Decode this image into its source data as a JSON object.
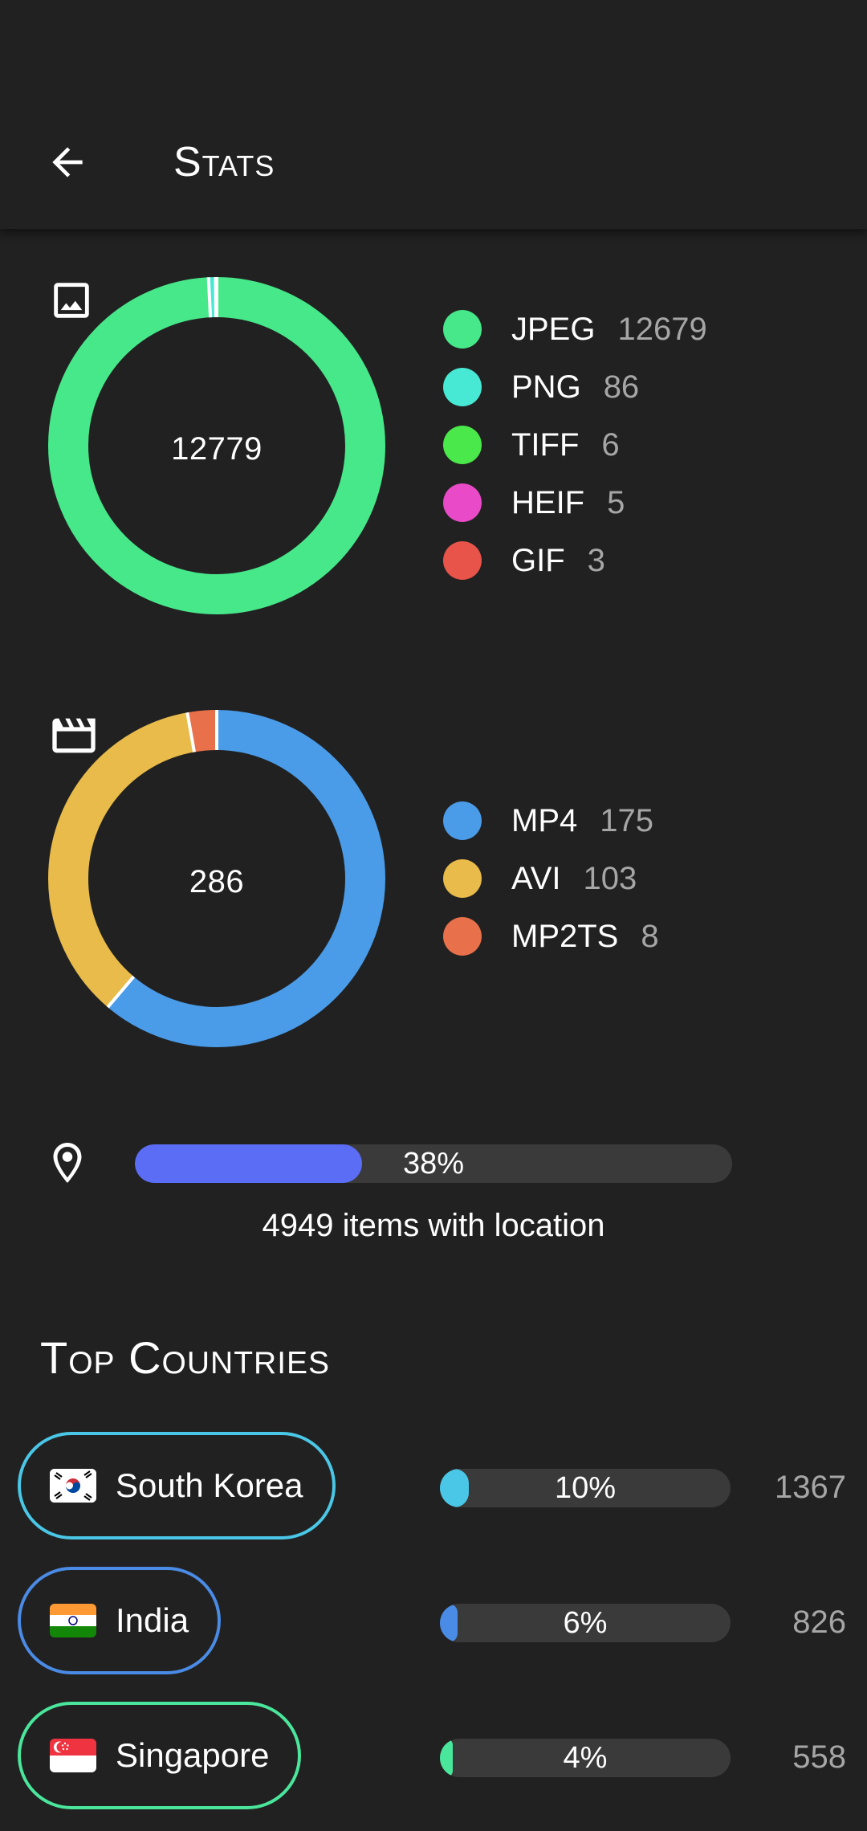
{
  "app_bar": {
    "title": "Stats",
    "back_icon": "arrow-left-icon"
  },
  "image_stats": {
    "icon": "image-icon",
    "total": "12779",
    "chart_data": {
      "type": "pie",
      "categories": [
        "JPEG",
        "PNG",
        "TIFF",
        "HEIF",
        "GIF"
      ],
      "values": [
        12679,
        86,
        6,
        5,
        3
      ],
      "colors": [
        "#47e88a",
        "#47e8d4",
        "#4ae84a",
        "#e84ac8",
        "#e8534a"
      ]
    },
    "legend": [
      {
        "name": "JPEG",
        "count": "12679",
        "color": "#47e88a"
      },
      {
        "name": "PNG",
        "count": "86",
        "color": "#47e8d4"
      },
      {
        "name": "TIFF",
        "count": "6",
        "color": "#4ae84a"
      },
      {
        "name": "HEIF",
        "count": "5",
        "color": "#e84ac8"
      },
      {
        "name": "GIF",
        "count": "3",
        "color": "#e8534a"
      }
    ]
  },
  "video_stats": {
    "icon": "movie-clapperboard-icon",
    "total": "286",
    "chart_data": {
      "type": "pie",
      "categories": [
        "MP4",
        "AVI",
        "MP2TS"
      ],
      "values": [
        175,
        103,
        8
      ],
      "colors": [
        "#4a9be8",
        "#e8bb4a",
        "#e8704a"
      ]
    },
    "legend": [
      {
        "name": "MP4",
        "count": "175",
        "color": "#4a9be8"
      },
      {
        "name": "AVI",
        "count": "103",
        "color": "#e8bb4a"
      },
      {
        "name": "MP2TS",
        "count": "8",
        "color": "#e8704a"
      }
    ]
  },
  "location": {
    "icon": "map-pin-icon",
    "percent_label": "38%",
    "fraction": 0.38,
    "caption": "4949 items with location",
    "bar_color": "#5b6cf5"
  },
  "top_countries": {
    "title": "Top Countries",
    "items": [
      {
        "name": "South Korea",
        "flag": "south-korea-flag-icon",
        "percent_label": "10%",
        "fraction": 0.1,
        "count": "1367",
        "color": "#4ac7e6"
      },
      {
        "name": "India",
        "flag": "india-flag-icon",
        "percent_label": "6%",
        "fraction": 0.06,
        "count": "826",
        "color": "#4a8be6"
      },
      {
        "name": "Singapore",
        "flag": "singapore-flag-icon",
        "percent_label": "4%",
        "fraction": 0.04,
        "count": "558",
        "color": "#4ae69b"
      }
    ]
  }
}
